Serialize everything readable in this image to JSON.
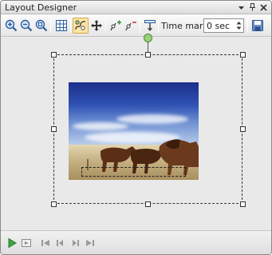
{
  "window": {
    "title": "Layout Designer",
    "buttons": [
      "dropdown-arrow",
      "pin",
      "close"
    ]
  },
  "toolbar": {
    "tools": [
      {
        "name": "zoom-in-icon",
        "label": "Zoom in"
      },
      {
        "name": "zoom-out-icon",
        "label": "Zoom out"
      },
      {
        "name": "zoom-fit-icon",
        "label": "Zoom to fit"
      },
      {
        "name": "grid-icon",
        "label": "Grid"
      },
      {
        "name": "motion-path-icon",
        "label": "Motion path",
        "active": true
      },
      {
        "name": "pan-icon",
        "label": "Pan"
      },
      {
        "name": "add-keyframe-icon",
        "label": "Add keyframe"
      },
      {
        "name": "remove-keyframe-icon",
        "label": "Remove keyframe"
      },
      {
        "name": "align-icon",
        "label": "Align"
      }
    ],
    "time_mark_label": "Time mark:",
    "time_mark_value": "0 sec",
    "save_icon": "save-icon"
  },
  "playback": {
    "buttons": [
      "play-icon",
      "preview-icon",
      "first-frame-icon",
      "previous-frame-icon",
      "next-frame-icon",
      "last-frame-icon"
    ]
  },
  "colors": {
    "rotate_handle": "#9bd07a",
    "active_tool": "#fbe6a6"
  }
}
